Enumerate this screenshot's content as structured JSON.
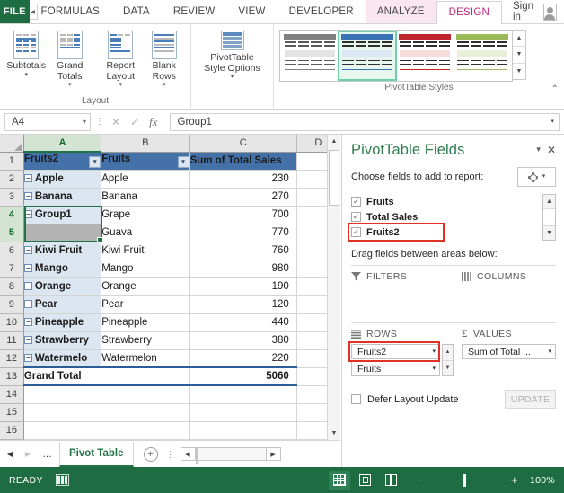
{
  "ribbon": {
    "file_tab": "FILE",
    "scroll_left_icon": "chevron-left-icon",
    "tabs": [
      {
        "label": "FORMULAS",
        "state": "clipped"
      },
      {
        "label": "DATA",
        "state": "normal"
      },
      {
        "label": "REVIEW",
        "state": "normal"
      },
      {
        "label": "VIEW",
        "state": "normal"
      },
      {
        "label": "DEVELOPER",
        "state": "normal"
      },
      {
        "label": "ANALYZE",
        "state": "contextual"
      },
      {
        "label": "DESIGN",
        "state": "active"
      }
    ],
    "sign_in": "Sign in",
    "collapse_icon": "chevron-up-icon",
    "groups": [
      {
        "label": "Layout",
        "buttons": [
          {
            "label": "Subtotals",
            "has_caret": true,
            "icon": "subtotals-icon"
          },
          {
            "label": "Grand Totals",
            "has_caret": true,
            "icon": "grand-totals-icon"
          },
          {
            "label": "Report Layout",
            "has_caret": true,
            "icon": "report-layout-icon"
          },
          {
            "label": "Blank Rows",
            "has_caret": true,
            "icon": "blank-rows-icon"
          }
        ]
      },
      {
        "label": "",
        "buttons": [
          {
            "label": "PivotTable Style Options",
            "has_caret": true,
            "icon": "pivottable-style-options-icon"
          }
        ]
      },
      {
        "label": "PivotTable Styles",
        "styles": [
          {
            "name": "style-gray",
            "accent": "#808080",
            "band": "#e4e4e4",
            "selected": false
          },
          {
            "name": "style-blue",
            "accent": "#3a72b8",
            "band": "#dbe7f4",
            "selected": true
          },
          {
            "name": "style-red",
            "accent": "#c0272d",
            "band": "#f7dcdc",
            "selected": false
          },
          {
            "name": "style-green",
            "accent": "#9bbb59",
            "band": "#e9f0da",
            "selected": false
          }
        ],
        "scroll_icons": [
          "up-arrow-icon",
          "down-arrow-icon",
          "more-styles-icon"
        ]
      }
    ]
  },
  "formula_bar": {
    "name_box_value": "A4",
    "cancel_icon": "cancel-icon",
    "enter_icon": "enter-icon",
    "function_icon": "fx-icon",
    "formula_value": "Group1",
    "expand_icon": "chevron-down-icon"
  },
  "grid": {
    "columns": [
      "A",
      "B",
      "C",
      "D"
    ],
    "selected_column": "A",
    "rows": [
      1,
      2,
      3,
      4,
      5,
      6,
      7,
      8,
      9,
      10,
      11,
      12,
      13,
      14,
      15,
      16
    ],
    "selected_rows": [
      4,
      5
    ],
    "selection_range": "A4:A5",
    "headers": {
      "a": "Fruits2",
      "b": "Fruits",
      "c": "Sum of Total Sales",
      "filter_icon": "filter-dropdown-icon"
    },
    "data": [
      {
        "row": 2,
        "a": "Apple",
        "collapse": "−",
        "b": "Apple",
        "c": "230"
      },
      {
        "row": 3,
        "a": "Banana",
        "collapse": "−",
        "b": "Banana",
        "c": "270"
      },
      {
        "row": 4,
        "a": "Group1",
        "collapse": "−",
        "b": "Grape",
        "c": "700"
      },
      {
        "row": 5,
        "a": "",
        "collapse": "",
        "b": "Guava",
        "c": "770"
      },
      {
        "row": 6,
        "a": "Kiwi Fruit",
        "collapse": "−",
        "b": "Kiwi Fruit",
        "c": "760"
      },
      {
        "row": 7,
        "a": "Mango",
        "collapse": "−",
        "b": "Mango",
        "c": "980"
      },
      {
        "row": 8,
        "a": "Orange",
        "collapse": "−",
        "b": "Orange",
        "c": "190"
      },
      {
        "row": 9,
        "a": "Pear",
        "collapse": "−",
        "b": "Pear",
        "c": "120"
      },
      {
        "row": 10,
        "a": "Pineapple",
        "collapse": "−",
        "b": "Pineapple",
        "c": "440"
      },
      {
        "row": 11,
        "a": "Strawberry",
        "collapse": "−",
        "b": "Strawberry",
        "c": "380"
      },
      {
        "row": 12,
        "a": "Watermelo",
        "collapse": "−",
        "b": "Watermelon",
        "c": "220"
      }
    ],
    "grand_total": {
      "row": 13,
      "label": "Grand Total",
      "value": "5060"
    },
    "empty_rows": [
      14,
      15,
      16
    ],
    "scroll_up_icon": "up-arrow-icon",
    "scroll_down_icon": "down-arrow-icon"
  },
  "sheet_bar": {
    "first_icon": "first-sheet-icon",
    "prev_icon": "prev-sheet-icon",
    "more_icon": "more-sheets-icon",
    "tabs": [
      {
        "label": "Pivot Table",
        "active": true
      }
    ],
    "add_sheet_icon": "add-sheet-icon",
    "handle_icon": "tab-split-handle-icon",
    "hscroll_left_icon": "left-arrow-icon",
    "hscroll_right_icon": "right-arrow-icon"
  },
  "fields_pane": {
    "title": "PivotTable Fields",
    "minimize_icon": "chevron-down-icon",
    "close_icon": "close-icon",
    "choose_label": "Choose fields to add to report:",
    "tools_icon": "gear-icon",
    "tools_caret_icon": "chevron-down-icon",
    "field_list": [
      {
        "name": "Fruits",
        "checked": true,
        "highlighted": false
      },
      {
        "name": "Total Sales",
        "checked": true,
        "highlighted": false
      },
      {
        "name": "Fruits2",
        "checked": true,
        "highlighted": true
      }
    ],
    "list_scroll_up_icon": "up-arrow-icon",
    "list_scroll_down_icon": "down-arrow-icon",
    "drag_label": "Drag fields between areas below:",
    "areas": [
      {
        "key": "filters",
        "label": "FILTERS",
        "icon": "filter-icon",
        "pills": []
      },
      {
        "key": "columns",
        "label": "COLUMNS",
        "icon": "columns-icon",
        "pills": []
      },
      {
        "key": "rows",
        "label": "ROWS",
        "icon": "rows-icon",
        "pills": [
          {
            "label": "Fruits2",
            "highlighted": true,
            "caret": "chevron-down-icon"
          },
          {
            "label": "Fruits",
            "highlighted": false,
            "caret": "chevron-down-icon"
          }
        ],
        "scroll_up_icon": "up-arrow-icon",
        "scroll_down_icon": "down-arrow-icon"
      },
      {
        "key": "values",
        "label": "VALUES",
        "icon": "sigma-icon",
        "pills": [
          {
            "label": "Sum of Total ...",
            "highlighted": false,
            "caret": "chevron-down-icon"
          }
        ]
      }
    ],
    "defer_label": "Defer Layout Update",
    "defer_checked": false,
    "update_button": "UPDATE"
  },
  "status_bar": {
    "state": "READY",
    "macro_icon": "record-macro-icon",
    "views": [
      {
        "name": "normal-view",
        "icon": "normal-view-icon",
        "active": true
      },
      {
        "name": "page-layout-view",
        "icon": "page-layout-icon",
        "active": false
      },
      {
        "name": "page-break-view",
        "icon": "page-break-icon",
        "active": false
      }
    ],
    "zoom_out_icon": "minus-icon",
    "zoom_in_icon": "plus-icon",
    "zoom_level": "100%"
  },
  "colors": {
    "excel_green": "#1e6c41",
    "ribbon_accent": "#217346",
    "contextual_pink": "#fae6f0",
    "design_tab_text": "#c3277b",
    "pivot_header_blue": "#4472a8",
    "pivot_row_blue": "#dce6f1",
    "highlight_red": "#e03127",
    "selection_green": "#217346"
  }
}
